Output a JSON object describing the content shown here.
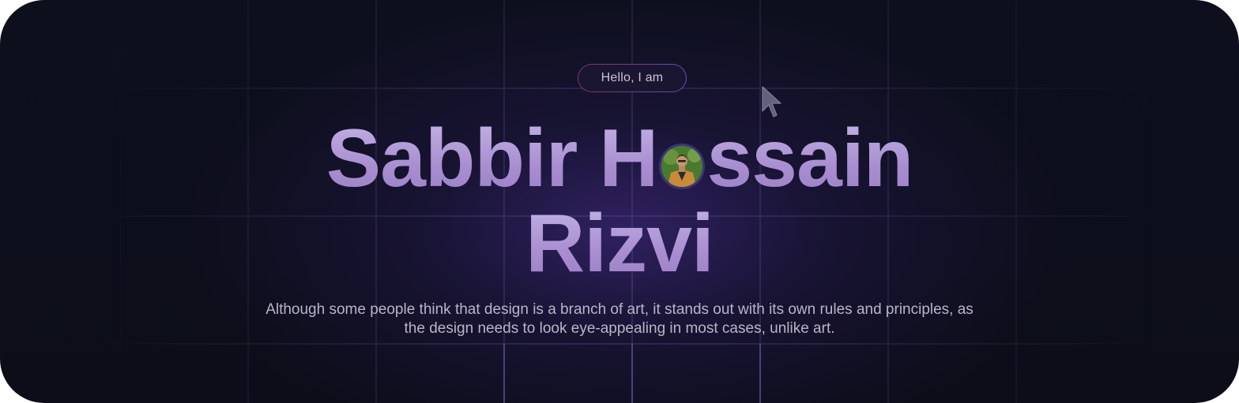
{
  "hero": {
    "greeting": "Hello, I am",
    "name_part1": "Sabbir H",
    "name_part2": "ssain",
    "name_line2": "Rizvi",
    "description": "Although some people think that design is a branch of art, it stands out with its own rules and principles, as the design needs to look eye-appealing in most cases, unlike art."
  },
  "icons": {
    "cursor": "cursor-arrow-icon",
    "avatar": "profile-photo-avatar"
  },
  "colors": {
    "background": "#0d0f1c",
    "glow": "#36246e",
    "heading": "#b29fd6",
    "body_text": "#b9b5c8",
    "grid_line": "#3a3560",
    "badge_border_start": "#7a3a5a",
    "badge_border_end": "#6a4ab0"
  }
}
